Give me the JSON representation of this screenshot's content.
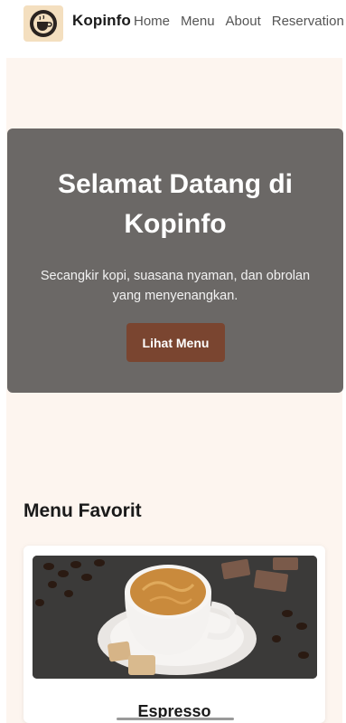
{
  "header": {
    "brand": "Kopinfo",
    "nav": [
      "Home",
      "Menu",
      "About",
      "Reservation"
    ]
  },
  "hero": {
    "title": "Selamat Datang di Kopinfo",
    "subtitle": "Secangkir kopi, suasana nyaman, dan obrolan yang menyenangkan.",
    "button_label": "Lihat Menu"
  },
  "menu_section": {
    "title": "Menu Favorit",
    "items": [
      {
        "name": "Espresso"
      }
    ]
  },
  "colors": {
    "accent": "#7a4530",
    "hero_bg": "#6b6866",
    "page_bg": "#fdf5ef"
  }
}
